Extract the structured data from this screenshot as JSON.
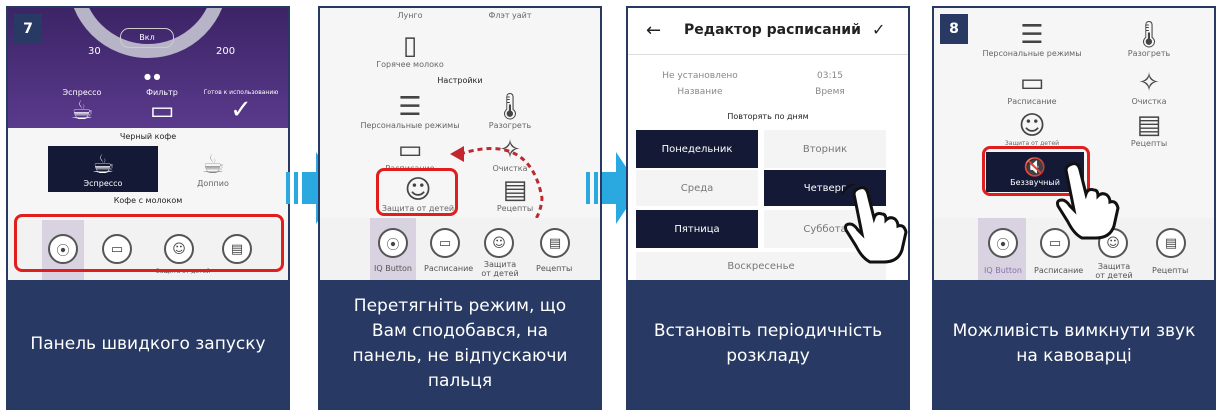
{
  "panel1": {
    "step": "7",
    "gauge_min": "30",
    "gauge_max": "200",
    "gauge_button": "Вкл",
    "modes": [
      "Эспрессо",
      "Фильтр",
      "Готов к использованию"
    ],
    "section_black": "Черный кофе",
    "drinks": [
      "Эспрессо",
      "Доппио"
    ],
    "section_milk": "Кофе с молоком",
    "dock": [
      "IQ Button",
      "Расписание",
      "Защита от детей",
      "Рецепты"
    ],
    "caption": "Панель швидкого запуску"
  },
  "panel2": {
    "top_labels": [
      "Лунго",
      "Флэт уайт"
    ],
    "hot_milk": "Горячее молоко",
    "section_settings": "Настройки",
    "items": [
      "Персональные режимы",
      "Разогреть",
      "Расписание",
      "Очистка",
      "Защита от детей",
      "Рецепты"
    ],
    "dock": [
      "IQ Button",
      "Расписание",
      "Защита от детей",
      "Рецепты"
    ],
    "caption": "Перетягніть режим, що Вам сподобався, на панель, не відпускаючи пальця"
  },
  "panel3": {
    "title": "Редактор расписаний",
    "not_set": "Не установлено",
    "time_value": "03:15",
    "name_label": "Название",
    "time_label": "Время",
    "repeat_label": "Повторять по дням",
    "days": [
      "Понедельник",
      "Вторник",
      "Среда",
      "Четверг",
      "Пятница",
      "Суббота",
      "Воскресенье"
    ],
    "caption": "Встановіть періодичність розкладу"
  },
  "panel4": {
    "step": "8",
    "items": [
      "Персональные режимы",
      "Разогреть",
      "Расписание",
      "Очистка",
      "Защита от детей",
      "Рецепты",
      "Беззвучный"
    ],
    "dock": [
      "IQ Button",
      "Расписание",
      "Защита от детей",
      "Рецепты"
    ],
    "caption": "Можливість вимкнути звук на кавоварці"
  },
  "colors": {
    "accent_dark": "#283a63",
    "highlight": "#e01e1e",
    "arrow": "#2aa9e0",
    "purple": "#4a2f7a"
  }
}
